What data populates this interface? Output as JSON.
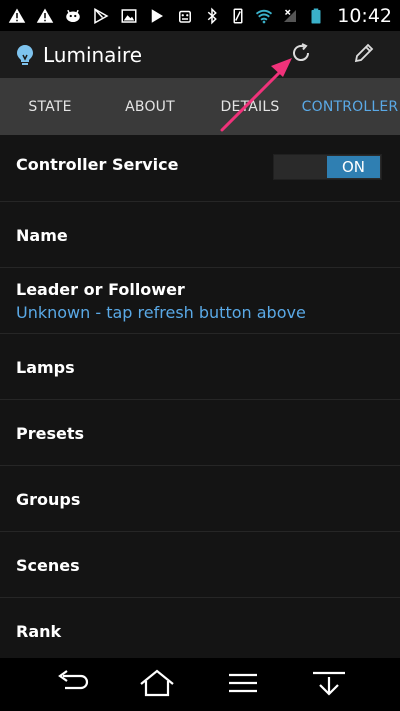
{
  "status_bar": {
    "time": "10:42",
    "icons": [
      "warning-icon",
      "warning-icon",
      "android-icon",
      "play-store-icon",
      "image-icon",
      "play-icon",
      "robot-icon",
      "bluetooth-icon",
      "vibrate-icon",
      "wifi-icon",
      "no-signal-icon",
      "battery-icon"
    ]
  },
  "app": {
    "title": "Luminaire",
    "icon": "lightbulb-icon",
    "actions": [
      "refresh-icon",
      "pencil-icon"
    ]
  },
  "tabs": [
    {
      "label": "STATE",
      "active": false
    },
    {
      "label": "ABOUT",
      "active": false
    },
    {
      "label": "DETAILS",
      "active": false
    },
    {
      "label": "CONTROLLER",
      "active": true
    }
  ],
  "controller": {
    "service_label": "Controller Service",
    "service_toggle": "ON",
    "name_label": "Name",
    "leader_label": "Leader or Follower",
    "leader_value": "Unknown - tap refresh button above",
    "lamps_label": "Lamps",
    "presets_label": "Presets",
    "groups_label": "Groups",
    "scenes_label": "Scenes",
    "rank_label": "Rank"
  },
  "colors": {
    "accent": "#5aa9e6",
    "toggle_on": "#2f7fb2",
    "annotation_arrow": "#f0327a"
  }
}
